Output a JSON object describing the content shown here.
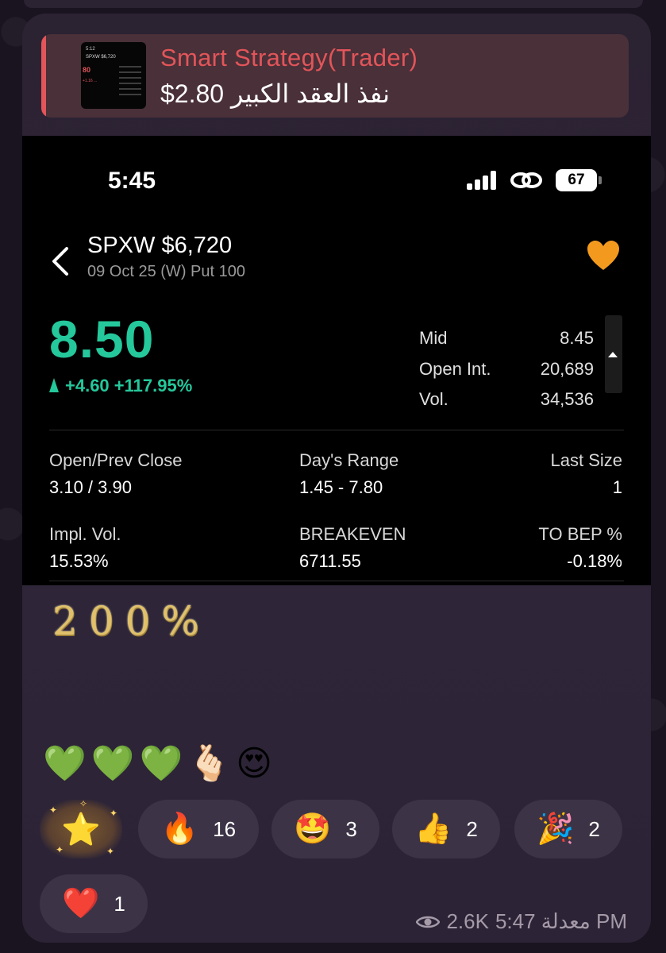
{
  "reply": {
    "title": "Smart Strategy(Trader)",
    "text": "نفذ العقد الكبير 2.80$",
    "thumb": {
      "time": "5:12",
      "symbol": "SPXW $6,720",
      "price": "80",
      "change": "+1.16 ..."
    }
  },
  "status_bar": {
    "time": "5:45",
    "battery": "67"
  },
  "quote": {
    "symbol": "SPXW $6,720",
    "contract": "09 Oct 25 (W) Put 100",
    "price": "8.50",
    "change": "+4.60 +117.95%",
    "mid_label": "Mid",
    "mid_value": "8.45",
    "open_int_label": "Open Int.",
    "open_int_value": "20,689",
    "vol_label": "Vol.",
    "vol_value": "34,536",
    "open_prev_label": "Open/Prev Close",
    "open_prev_value": "3.10 / 3.90",
    "days_range_label": "Day's Range",
    "days_range_value": "1.45 - 7.80",
    "last_size_label": "Last Size",
    "last_size_value": "1",
    "impl_vol_label": "Impl. Vol.",
    "impl_vol_value": "15.53%",
    "breakeven_label": "BREAKEVEN",
    "breakeven_value": "6711.55",
    "to_bep_label": "TO BEP %",
    "to_bep_value": "-0.18%"
  },
  "message": {
    "big_text": "200%",
    "emojis": "💚💚💚🫰🏻😍"
  },
  "reactions": [
    {
      "emoji": "🔥",
      "count": "16"
    },
    {
      "emoji": "🤩",
      "count": "3"
    },
    {
      "emoji": "👍",
      "count": "2"
    },
    {
      "emoji": "🎉",
      "count": "2"
    },
    {
      "emoji": "❤️",
      "count": "1"
    }
  ],
  "paid_reaction": {
    "emoji": "⭐"
  },
  "meta": {
    "views": "2.6K",
    "time": "5:47 معدلة PM"
  },
  "colors": {
    "accent_green": "#24c89b",
    "reply_red": "#e2555a",
    "heart_orange": "#f39a1e"
  }
}
